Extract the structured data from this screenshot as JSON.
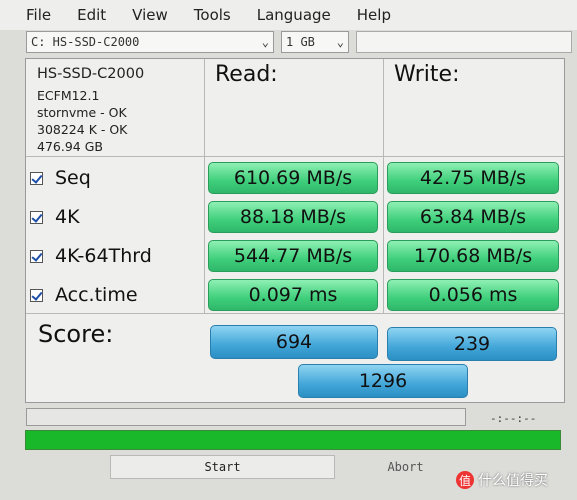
{
  "menu": [
    "File",
    "Edit",
    "View",
    "Tools",
    "Language",
    "Help"
  ],
  "toolbar": {
    "drive": "C: HS-SSD-C2000",
    "size": "1 GB"
  },
  "info": {
    "drive_name": "HS-SSD-C2000",
    "firmware": "ECFM12.1",
    "driver": "stornvme - OK",
    "alignment": "308224 K - OK",
    "capacity": "476.94 GB"
  },
  "columns": {
    "read": "Read:",
    "write": "Write:"
  },
  "rows": [
    {
      "label": "Seq",
      "read": "610.69 MB/s",
      "write": "42.75 MB/s"
    },
    {
      "label": "4K",
      "read": "88.18 MB/s",
      "write": "63.84 MB/s"
    },
    {
      "label": "4K-64Thrd",
      "read": "544.77 MB/s",
      "write": "170.68 MB/s"
    },
    {
      "label": "Acc.time",
      "read": "0.097 ms",
      "write": "0.056 ms"
    }
  ],
  "score": {
    "label": "Score:",
    "read": "694",
    "write": "239",
    "total": "1296"
  },
  "status": {
    "time": "-:--:--"
  },
  "buttons": {
    "start": "Start",
    "abort": "Abort"
  },
  "watermark": {
    "badge": "值",
    "text": "什么值得买"
  },
  "colors": {
    "result_green": "#3fcf7b",
    "score_blue": "#42a6d8",
    "progress_green": "#18b82a"
  }
}
